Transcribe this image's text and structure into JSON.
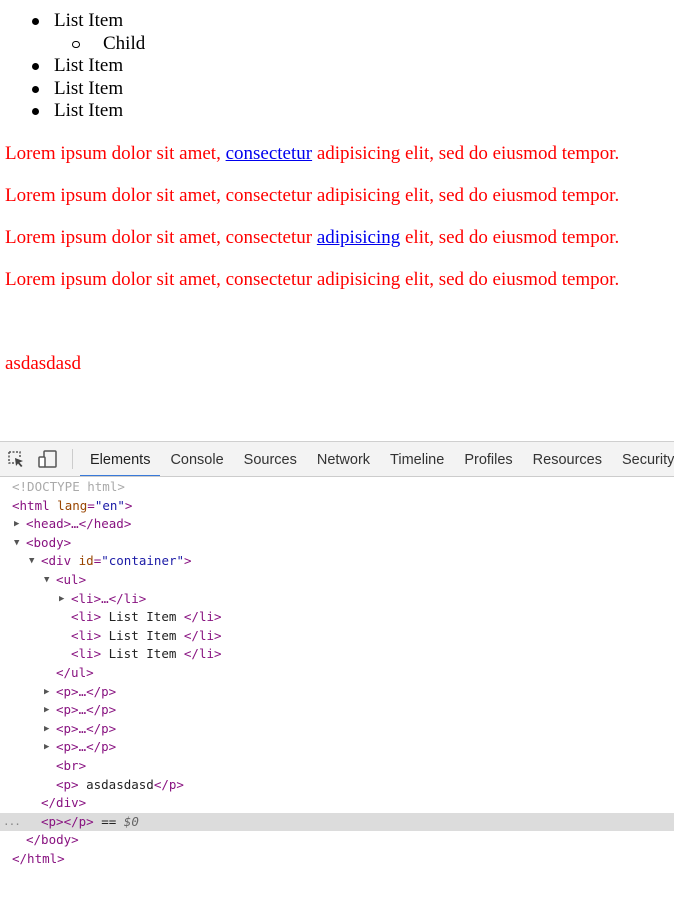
{
  "page": {
    "list_items": [
      {
        "label": "List Item",
        "child": "Child"
      },
      {
        "label": "List Item"
      },
      {
        "label": "List Item"
      },
      {
        "label": "List Item"
      }
    ],
    "paragraphs": [
      {
        "before": "Lorem ipsum dolor sit amet, ",
        "link": "consectetur",
        "after": " adipisicing elit, sed do eiusmod tempor."
      },
      {
        "before": "Lorem ipsum dolor sit amet, consectetur adipisicing elit, sed do eiusmod tempor.",
        "link": "",
        "after": ""
      },
      {
        "before": "Lorem ipsum dolor sit amet, consectetur ",
        "link": "adipisicing",
        "after": " elit, sed do eiusmod tempor."
      },
      {
        "before": "Lorem ipsum dolor sit amet, consectetur adipisicing elit, sed do eiusmod tempor.",
        "link": "",
        "after": ""
      }
    ],
    "last_paragraph": "asdasdasd",
    "colors": {
      "text": "#ff0000",
      "link": "#0000ee"
    }
  },
  "devtools": {
    "tabs": [
      "Elements",
      "Console",
      "Sources",
      "Network",
      "Timeline",
      "Profiles",
      "Resources",
      "Security"
    ],
    "active_tab": "Elements",
    "icons": {
      "inspect": "inspect-element-icon",
      "device": "device-mode-icon"
    },
    "tree": {
      "doctype": "<!DOCTYPE html>",
      "html_open": "<html",
      "html_attr_name": "lang",
      "html_attr_val": "\"en\"",
      "html_close_bracket": ">",
      "head": "<head>…</head>",
      "body_open": "<body>",
      "div_open": "<div",
      "div_attr_name": "id",
      "div_attr_val": "\"container\"",
      "div_close_bracket": ">",
      "ul_open": "<ul>",
      "li_collapsed": "<li>…</li>",
      "li_open": "<li>",
      "li_text": " List Item ",
      "li_close": "</li>",
      "ul_close": "</ul>",
      "p_collapsed": "<p>…</p>",
      "br": "<br>",
      "p_open": "<p>",
      "p_text": " asdasdasd",
      "p_close": "</p>",
      "div_close": "</div>",
      "p_empty": "<p></p>",
      "eq_marker": " == ",
      "dollar_zero": "$0",
      "selected_dots": "...",
      "body_close": "</body>",
      "html_close": "</html>"
    },
    "colors": {
      "tag": "#881280",
      "attr_name": "#994500",
      "attr_val": "#1a1aa6",
      "selection_bg": "#dcdcdc",
      "active_tab_underline": "#3879d9"
    }
  }
}
